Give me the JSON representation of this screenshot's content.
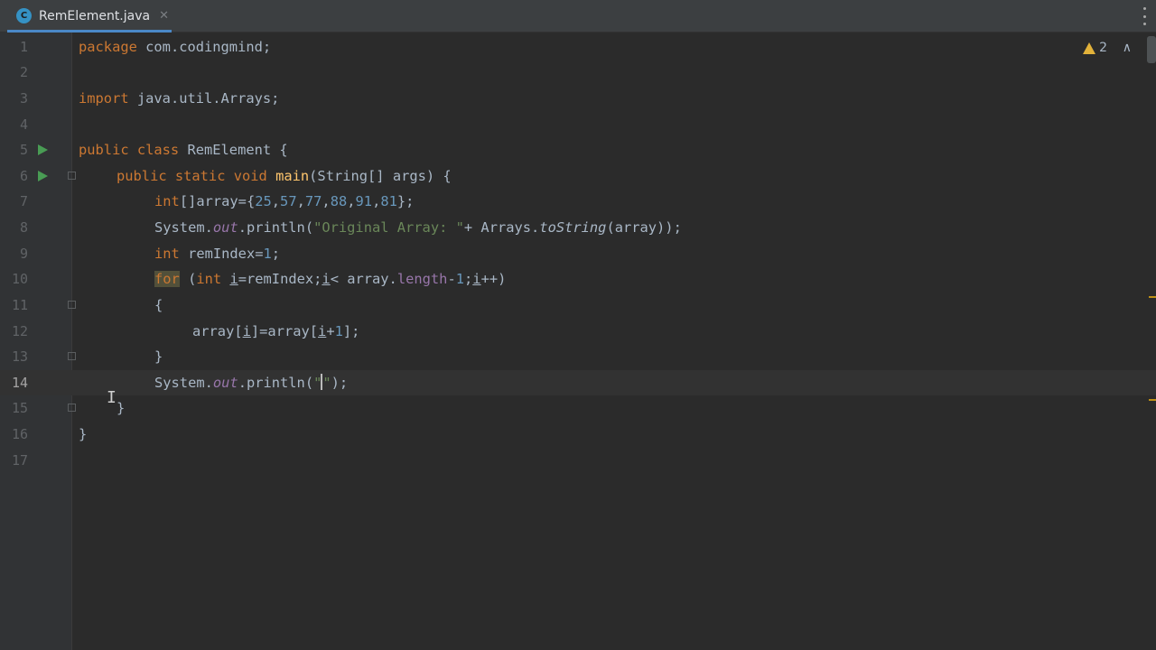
{
  "tab": {
    "icon_letter": "C",
    "title": "RemElement.java",
    "close": "✕"
  },
  "inspections": {
    "warning_count": "2",
    "nav_up": "∧"
  },
  "editor": {
    "current_line": 14,
    "line_numbers": [
      "1",
      "2",
      "3",
      "4",
      "5",
      "6",
      "7",
      "8",
      "9",
      "10",
      "11",
      "12",
      "13",
      "14",
      "15",
      "16",
      "17"
    ]
  },
  "code": {
    "l1": [
      "package",
      " com.codingmind;"
    ],
    "l3": [
      "import",
      " java.util.Arrays;"
    ],
    "l5": [
      "public class",
      " RemElement {"
    ],
    "l6": [
      "public static void",
      " ",
      "main",
      "(String[] args) {"
    ],
    "l7": [
      "int",
      "[]array={",
      "25",
      ",",
      "57",
      ",",
      "77",
      ",",
      "88",
      ",",
      "91",
      ",",
      "81",
      "};"
    ],
    "l8": [
      "System.",
      "out",
      ".println(",
      "\"Original Array: \"",
      "+ Arrays.",
      "toString",
      "(array));"
    ],
    "l9": [
      "int",
      " remIndex=",
      "1",
      ";"
    ],
    "l10": [
      "for",
      " (",
      "int",
      " ",
      "i",
      "=remIndex;",
      "i",
      "< array.",
      "length",
      "-",
      "1",
      ";",
      "i",
      "++)"
    ],
    "l11": "{",
    "l12": [
      "array[",
      "i",
      "]=array[",
      "i",
      "+",
      "1",
      "];"
    ],
    "l13": "}",
    "l14": [
      "System.",
      "out",
      ".println(",
      "\"",
      "\"",
      ");"
    ],
    "l15": "}",
    "l16": "}"
  },
  "colors": {
    "background": "#2b2b2b",
    "keyword": "#cc7832",
    "method": "#ffc66d",
    "number": "#6897bb",
    "string": "#6a8759",
    "field": "#9876aa",
    "warning": "#e2b23a",
    "run": "#499c54"
  }
}
